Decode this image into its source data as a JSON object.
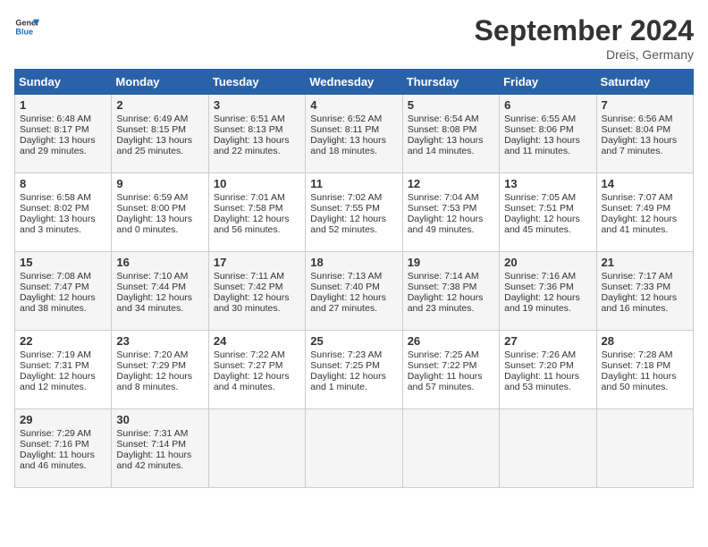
{
  "header": {
    "logo_line1": "General",
    "logo_line2": "Blue",
    "month": "September 2024",
    "location": "Dreis, Germany"
  },
  "days_of_week": [
    "Sunday",
    "Monday",
    "Tuesday",
    "Wednesday",
    "Thursday",
    "Friday",
    "Saturday"
  ],
  "weeks": [
    [
      {
        "day": "1",
        "lines": [
          "Sunrise: 6:48 AM",
          "Sunset: 8:17 PM",
          "Daylight: 13 hours",
          "and 29 minutes."
        ]
      },
      {
        "day": "2",
        "lines": [
          "Sunrise: 6:49 AM",
          "Sunset: 8:15 PM",
          "Daylight: 13 hours",
          "and 25 minutes."
        ]
      },
      {
        "day": "3",
        "lines": [
          "Sunrise: 6:51 AM",
          "Sunset: 8:13 PM",
          "Daylight: 13 hours",
          "and 22 minutes."
        ]
      },
      {
        "day": "4",
        "lines": [
          "Sunrise: 6:52 AM",
          "Sunset: 8:11 PM",
          "Daylight: 13 hours",
          "and 18 minutes."
        ]
      },
      {
        "day": "5",
        "lines": [
          "Sunrise: 6:54 AM",
          "Sunset: 8:08 PM",
          "Daylight: 13 hours",
          "and 14 minutes."
        ]
      },
      {
        "day": "6",
        "lines": [
          "Sunrise: 6:55 AM",
          "Sunset: 8:06 PM",
          "Daylight: 13 hours",
          "and 11 minutes."
        ]
      },
      {
        "day": "7",
        "lines": [
          "Sunrise: 6:56 AM",
          "Sunset: 8:04 PM",
          "Daylight: 13 hours",
          "and 7 minutes."
        ]
      }
    ],
    [
      {
        "day": "8",
        "lines": [
          "Sunrise: 6:58 AM",
          "Sunset: 8:02 PM",
          "Daylight: 13 hours",
          "and 3 minutes."
        ]
      },
      {
        "day": "9",
        "lines": [
          "Sunrise: 6:59 AM",
          "Sunset: 8:00 PM",
          "Daylight: 13 hours",
          "and 0 minutes."
        ]
      },
      {
        "day": "10",
        "lines": [
          "Sunrise: 7:01 AM",
          "Sunset: 7:58 PM",
          "Daylight: 12 hours",
          "and 56 minutes."
        ]
      },
      {
        "day": "11",
        "lines": [
          "Sunrise: 7:02 AM",
          "Sunset: 7:55 PM",
          "Daylight: 12 hours",
          "and 52 minutes."
        ]
      },
      {
        "day": "12",
        "lines": [
          "Sunrise: 7:04 AM",
          "Sunset: 7:53 PM",
          "Daylight: 12 hours",
          "and 49 minutes."
        ]
      },
      {
        "day": "13",
        "lines": [
          "Sunrise: 7:05 AM",
          "Sunset: 7:51 PM",
          "Daylight: 12 hours",
          "and 45 minutes."
        ]
      },
      {
        "day": "14",
        "lines": [
          "Sunrise: 7:07 AM",
          "Sunset: 7:49 PM",
          "Daylight: 12 hours",
          "and 41 minutes."
        ]
      }
    ],
    [
      {
        "day": "15",
        "lines": [
          "Sunrise: 7:08 AM",
          "Sunset: 7:47 PM",
          "Daylight: 12 hours",
          "and 38 minutes."
        ]
      },
      {
        "day": "16",
        "lines": [
          "Sunrise: 7:10 AM",
          "Sunset: 7:44 PM",
          "Daylight: 12 hours",
          "and 34 minutes."
        ]
      },
      {
        "day": "17",
        "lines": [
          "Sunrise: 7:11 AM",
          "Sunset: 7:42 PM",
          "Daylight: 12 hours",
          "and 30 minutes."
        ]
      },
      {
        "day": "18",
        "lines": [
          "Sunrise: 7:13 AM",
          "Sunset: 7:40 PM",
          "Daylight: 12 hours",
          "and 27 minutes."
        ]
      },
      {
        "day": "19",
        "lines": [
          "Sunrise: 7:14 AM",
          "Sunset: 7:38 PM",
          "Daylight: 12 hours",
          "and 23 minutes."
        ]
      },
      {
        "day": "20",
        "lines": [
          "Sunrise: 7:16 AM",
          "Sunset: 7:36 PM",
          "Daylight: 12 hours",
          "and 19 minutes."
        ]
      },
      {
        "day": "21",
        "lines": [
          "Sunrise: 7:17 AM",
          "Sunset: 7:33 PM",
          "Daylight: 12 hours",
          "and 16 minutes."
        ]
      }
    ],
    [
      {
        "day": "22",
        "lines": [
          "Sunrise: 7:19 AM",
          "Sunset: 7:31 PM",
          "Daylight: 12 hours",
          "and 12 minutes."
        ]
      },
      {
        "day": "23",
        "lines": [
          "Sunrise: 7:20 AM",
          "Sunset: 7:29 PM",
          "Daylight: 12 hours",
          "and 8 minutes."
        ]
      },
      {
        "day": "24",
        "lines": [
          "Sunrise: 7:22 AM",
          "Sunset: 7:27 PM",
          "Daylight: 12 hours",
          "and 4 minutes."
        ]
      },
      {
        "day": "25",
        "lines": [
          "Sunrise: 7:23 AM",
          "Sunset: 7:25 PM",
          "Daylight: 12 hours",
          "and 1 minute."
        ]
      },
      {
        "day": "26",
        "lines": [
          "Sunrise: 7:25 AM",
          "Sunset: 7:22 PM",
          "Daylight: 11 hours",
          "and 57 minutes."
        ]
      },
      {
        "day": "27",
        "lines": [
          "Sunrise: 7:26 AM",
          "Sunset: 7:20 PM",
          "Daylight: 11 hours",
          "and 53 minutes."
        ]
      },
      {
        "day": "28",
        "lines": [
          "Sunrise: 7:28 AM",
          "Sunset: 7:18 PM",
          "Daylight: 11 hours",
          "and 50 minutes."
        ]
      }
    ],
    [
      {
        "day": "29",
        "lines": [
          "Sunrise: 7:29 AM",
          "Sunset: 7:16 PM",
          "Daylight: 11 hours",
          "and 46 minutes."
        ]
      },
      {
        "day": "30",
        "lines": [
          "Sunrise: 7:31 AM",
          "Sunset: 7:14 PM",
          "Daylight: 11 hours",
          "and 42 minutes."
        ]
      },
      {
        "day": "",
        "lines": []
      },
      {
        "day": "",
        "lines": []
      },
      {
        "day": "",
        "lines": []
      },
      {
        "day": "",
        "lines": []
      },
      {
        "day": "",
        "lines": []
      }
    ]
  ]
}
